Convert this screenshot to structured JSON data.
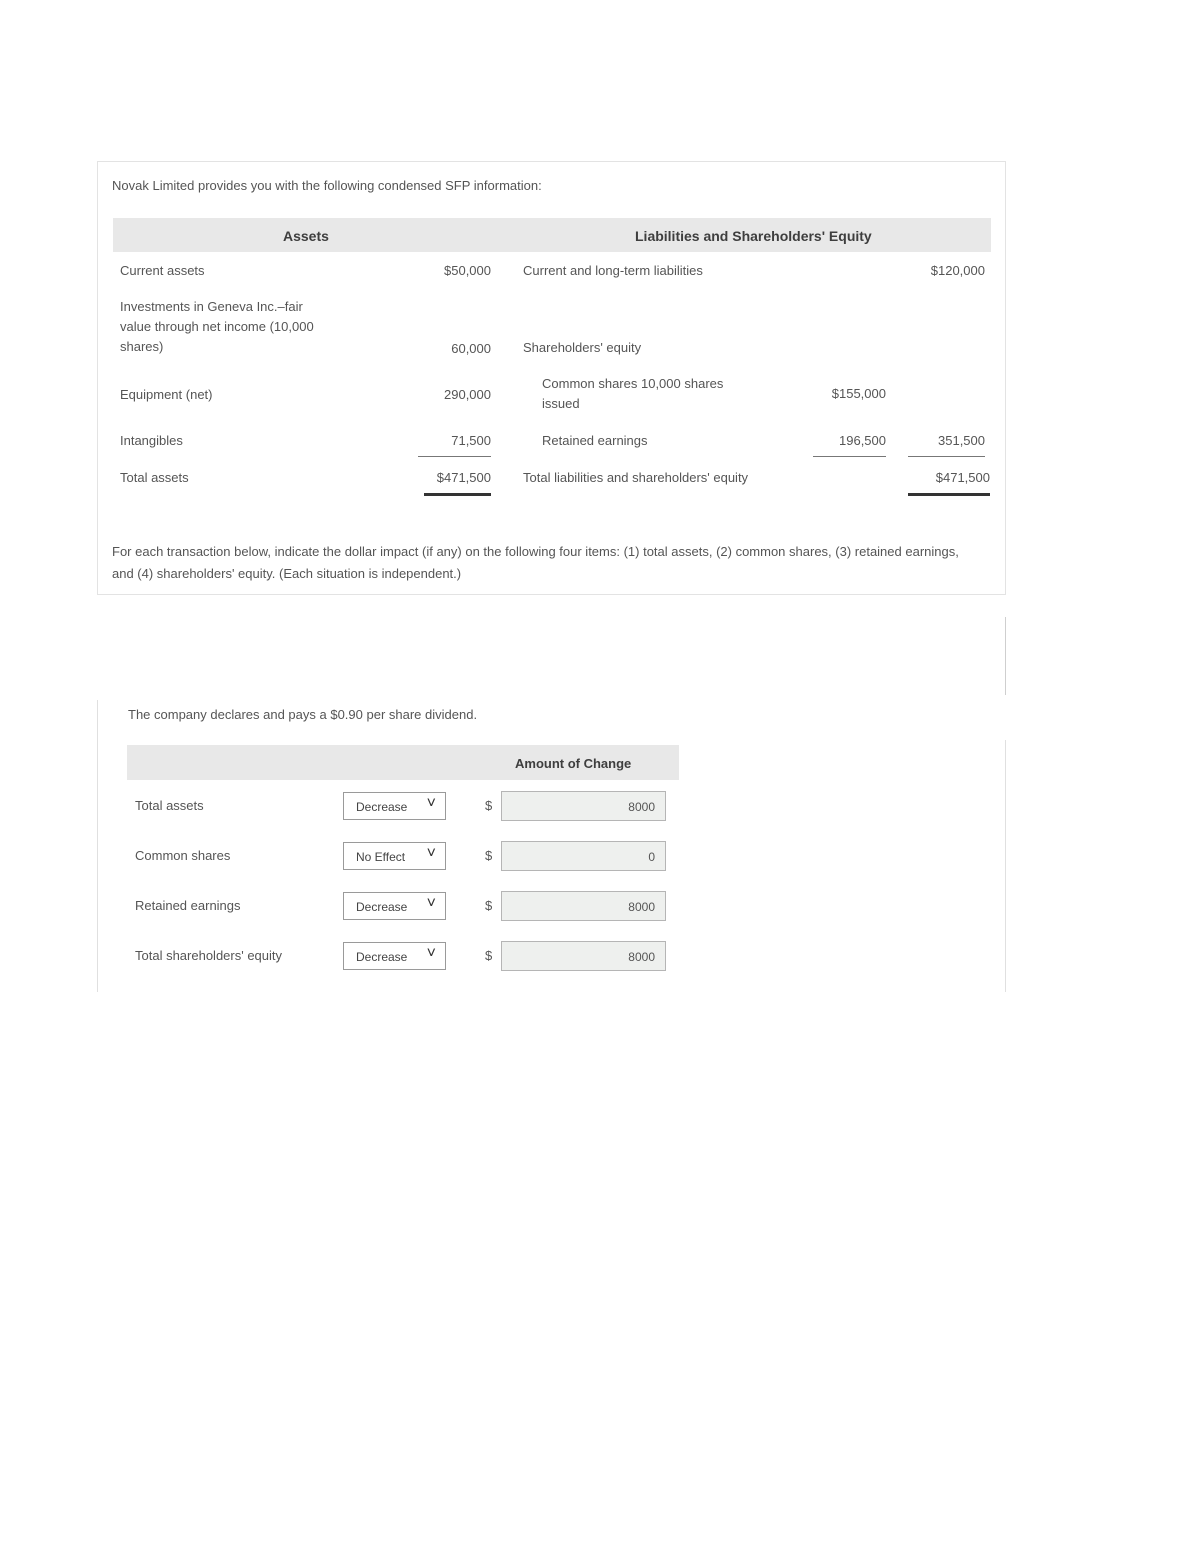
{
  "intro": "Novak Limited provides you with the following condensed SFP information:",
  "sfp": {
    "assets_header": "Assets",
    "liab_header": "Liabilities and Shareholders' Equity",
    "current_assets": {
      "label": "Current assets",
      "value": "$50,000"
    },
    "investments": {
      "label_line1": "Investments in Geneva Inc.–fair",
      "label_line2": "value through net income (10,000",
      "label_line3": "shares)",
      "value": "60,000"
    },
    "equipment": {
      "label": "Equipment (net)",
      "value": "290,000"
    },
    "intangibles": {
      "label": "Intangibles",
      "value": "71,500"
    },
    "total_assets": {
      "label": "Total assets",
      "value": "$471,500"
    },
    "liabilities": {
      "label": "Current and long-term liabilities",
      "value": "$120,000"
    },
    "shareholders_equity": {
      "label": "Shareholders' equity"
    },
    "common_shares": {
      "label_line1": "Common shares 10,000 shares",
      "label_line2": "issued",
      "value": "$155,000"
    },
    "retained_earnings": {
      "label": "Retained earnings",
      "value": "196,500",
      "total": "351,500"
    },
    "total_liab_equity": {
      "label": "Total liabilities and shareholders' equity",
      "value": "$471,500"
    }
  },
  "instructions": "For each transaction below, indicate the dollar impact (if any) on the following four items: (1) total assets, (2) common shares, (3) retained earnings, and (4) shareholders' equity. (Each situation is independent.)",
  "question": "The company declares and pays a $0.90 per share dividend.",
  "amount_header": "Amount of Change",
  "rows": [
    {
      "label": "Total assets",
      "effect": "Decrease",
      "currency": "$",
      "amount": "8000"
    },
    {
      "label": "Common shares",
      "effect": "No Effect",
      "currency": "$",
      "amount": "0"
    },
    {
      "label": "Retained earnings",
      "effect": "Decrease",
      "currency": "$",
      "amount": "8000"
    },
    {
      "label": "Total shareholders' equity",
      "effect": "Decrease",
      "currency": "$",
      "amount": "8000"
    }
  ],
  "icons": {
    "dropdown": "chevron-down-icon"
  }
}
